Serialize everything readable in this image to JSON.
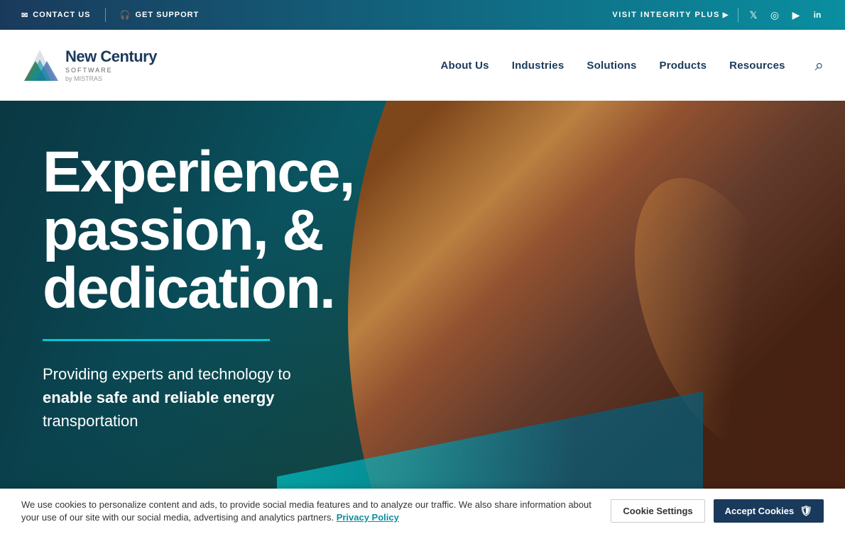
{
  "topbar": {
    "contact_label": "CONTACT US",
    "support_label": "GET SUPPORT",
    "visit_label": "VISIT INTEGRITY PLUS",
    "social": {
      "twitter": "Twitter",
      "instagram": "Instagram",
      "youtube": "YouTube",
      "linkedin": "LinkedIn"
    }
  },
  "nav": {
    "logo_main": "New Century",
    "logo_sub": "SOFTWARE",
    "logo_by": "by MISTRAS",
    "links": [
      {
        "id": "about",
        "label": "About Us"
      },
      {
        "id": "industries",
        "label": "Industries"
      },
      {
        "id": "solutions",
        "label": "Solutions"
      },
      {
        "id": "products",
        "label": "Products"
      },
      {
        "id": "resources",
        "label": "Resources"
      }
    ]
  },
  "hero": {
    "title_line1": "Experience,",
    "title_line2": "passion, &",
    "title_line3": "dedication.",
    "subtitle_line1": "Providing experts and technology to",
    "subtitle_line2_pre": "enable safe and",
    "subtitle_line2_em1": "reliable",
    "subtitle_line2_post": "energy",
    "subtitle_line3": "transportation"
  },
  "cookie": {
    "text": "We use cookies to personalize content and ads, to provide social media features and to analyze our traffic. We also share information about your use of our site with our social media, advertising and analytics partners.",
    "privacy_link": "Privacy Policy",
    "settings_label": "Cookie Settings",
    "accept_label": "Accept Cookies"
  }
}
